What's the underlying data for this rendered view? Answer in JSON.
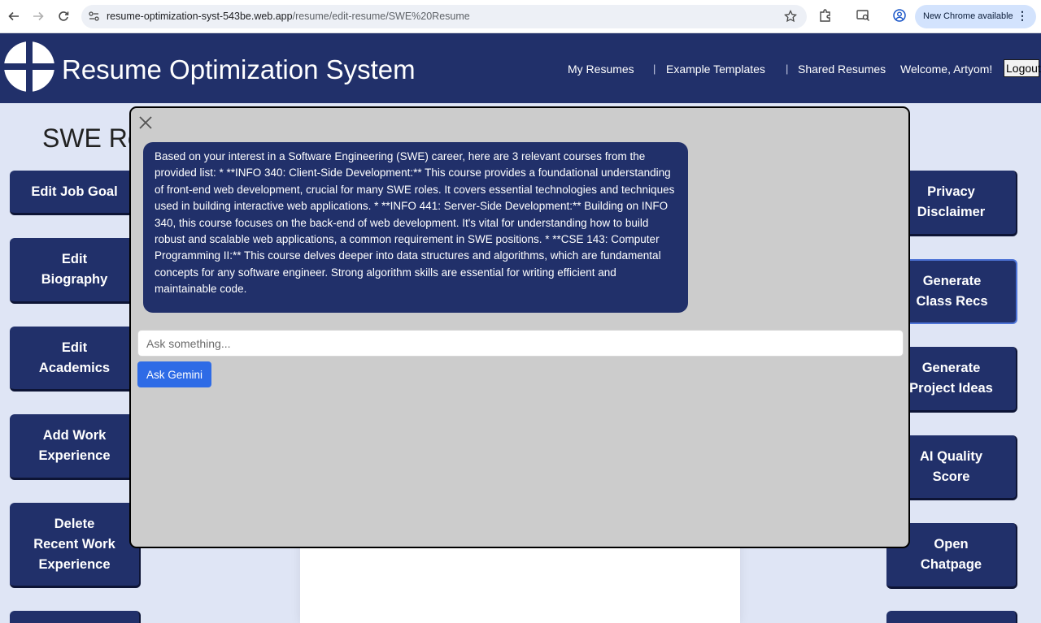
{
  "browser": {
    "url_host": "resume-optimization-syst-543be.web.app",
    "url_path": "/resume/edit-resume/SWE%20Resume",
    "update_label": "New Chrome available",
    "icons": [
      "back-arrow-icon",
      "forward-arrow-icon",
      "reload-icon",
      "site-settings-icon",
      "bookmark-star-icon",
      "extensions-icon",
      "cast-icon",
      "profile-icon",
      "more-menu-icon"
    ]
  },
  "header": {
    "title": "Resume Optimization System",
    "nav": {
      "my_resumes": "My Resumes",
      "separator": "|",
      "templates": "Example Templates",
      "shared": "Shared Resumes",
      "welcome": "Welcome, Artyom!",
      "logout": "Logout"
    },
    "brand_color": "#21306a"
  },
  "page": {
    "heading": "SWE Re"
  },
  "left_buttons": {
    "job_goal": "Edit Job Goal",
    "biography": "Edit\nBiography",
    "academics": "Edit\nAcademics",
    "add_work": "Add Work\nExperience",
    "delete_work": "Delete\nRecent Work\nExperience"
  },
  "right_buttons": {
    "privacy": "Privacy\nDisclaimer",
    "class_recs": "Generate\nClass Recs",
    "project_ideas": "Generate\nProject Ideas",
    "quality_score": "AI Quality\nScore",
    "chatpage": "Open\nChatpage"
  },
  "modal": {
    "response": "Based on your interest in a Software Engineering (SWE) career, here are 3 relevant courses from the provided list: * **INFO 340: Client-Side Development:** This course provides a foundational understanding of front-end web development, crucial for many SWE roles. It covers essential technologies and techniques used in building interactive web applications. * **INFO 441: Server-Side Development:** Building on INFO 340, this course focuses on the back-end of web development. It's vital for understanding how to build robust and scalable web applications, a common requirement in SWE positions. * **CSE 143: Computer Programming II:** This course delves deeper into data structures and algorithms, which are fundamental concepts for any software engineer. Strong algorithm skills are essential for writing efficient and maintainable code.",
    "input_placeholder": "Ask something...",
    "input_value": "",
    "ask_button": "Ask Gemini",
    "accent_color": "#2e6be6"
  }
}
